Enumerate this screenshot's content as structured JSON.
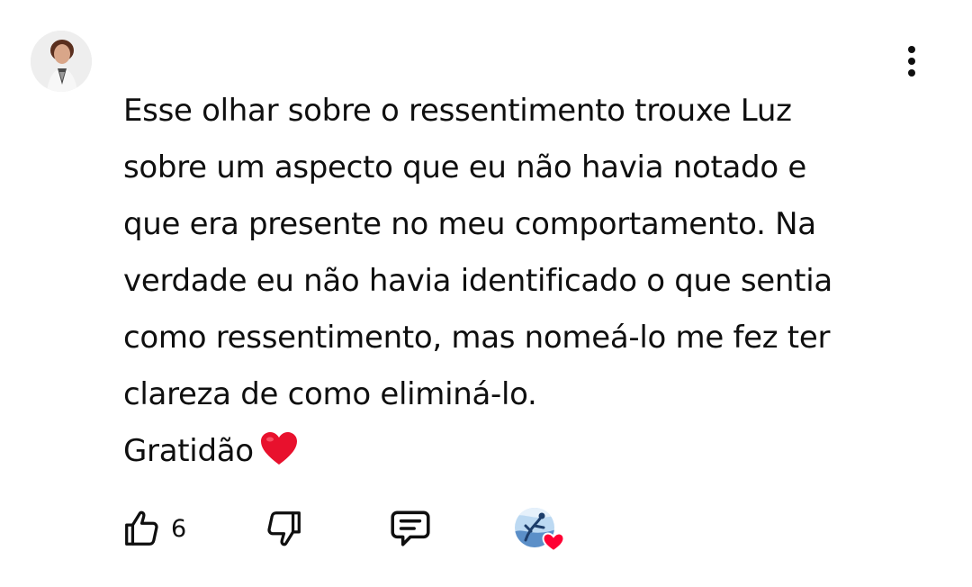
{
  "comment": {
    "lines": [
      "Esse olhar sobre o ressentimento trouxe Luz",
      "sobre um aspecto que eu não havia notado e",
      "que era presente no meu comportamento. Na",
      "verdade eu não havia identificado o que sentia",
      "como ressentimento, mas nomeá-lo me fez ter",
      "clareza de como eliminá-lo.",
      "Gratidão"
    ],
    "emoji": "red-heart-emoji"
  },
  "actions": {
    "like_count": "6",
    "like_icon": "thumbs-up-icon",
    "dislike_icon": "thumbs-down-icon",
    "reply_icon": "reply-comment-icon",
    "more_icon": "more-vertical-icon",
    "hearted_badge": "creator-heart-badge"
  },
  "colors": {
    "text": "#0f0f0f",
    "background": "#ffffff",
    "heart": "#e8112d"
  }
}
